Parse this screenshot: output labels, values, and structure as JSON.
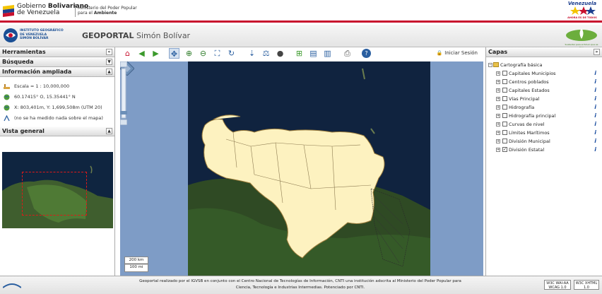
{
  "topbar": {
    "gov_title_light": "Gobierno ",
    "gov_title_bold": "Bolivariano",
    "gov_title_line2": "de Venezuela",
    "ministry_line1": "Ministerio del Poder Popular",
    "ministry_line2_prefix": "para el ",
    "ministry_line2_bold": "Ambiente",
    "badge_text": "Venezuela",
    "badge_subtext": "AHORA ES DE TODOS"
  },
  "header": {
    "institute_line1": "INSTITUTO GEOGRÁFICO",
    "institute_line2": "DE VENEZUELA",
    "institute_line3": "SIMÓN BOLÍVAR",
    "title_bold": "GEOPORTAL",
    "title_light": " Simón Bolívar",
    "eco_caption": "Sustentar para el futuro que es hoy"
  },
  "left_panel": {
    "tools_title": "Herramientas",
    "search_title": "Búsqueda",
    "info_title": "Información ampliada",
    "scale_text": "Escala = 1 : 10,000,000",
    "geo_coords": "60.17415° O, 15.35441° N",
    "utm_coords": "X: 803,401m, Y: 1,699,508m (UTM 20)",
    "measure_text": "(no se ha medido nada sobre el mapa)",
    "overview_title": "Vista general",
    "collapse_glyph": "«",
    "toggle_glyph": "▼",
    "up_glyph": "▲"
  },
  "toolbar": {
    "login_label": "Iniciar Sesión",
    "icons": [
      "home-icon",
      "back-arrow-icon",
      "forward-arrow-icon",
      "pan-icon",
      "zoom-in-icon",
      "zoom-out-icon",
      "zoom-extent-icon",
      "refresh-icon",
      "select-icon",
      "measure-icon",
      "info-icon",
      "add-layer-icon",
      "open-folder-icon",
      "document-icon",
      "print-icon",
      "help-icon"
    ]
  },
  "map": {
    "scale_km": "200 km",
    "scale_mi": "100 mi"
  },
  "right_panel": {
    "title": "Capas",
    "expand_glyph": "»",
    "root_label": "Cartografía básica",
    "info_glyph": "i",
    "layers": [
      {
        "label": "Capitales Municipios",
        "checked": false
      },
      {
        "label": "Centros poblados",
        "checked": false
      },
      {
        "label": "Capitales Estados",
        "checked": false
      },
      {
        "label": "Vías Principal",
        "checked": false
      },
      {
        "label": "Hidrografía",
        "checked": false
      },
      {
        "label": "Hidrografía principal",
        "checked": false
      },
      {
        "label": "Curvas de nivel",
        "checked": false
      },
      {
        "label": "Límites Marítimos",
        "checked": false
      },
      {
        "label": "División Municipal",
        "checked": false
      },
      {
        "label": "División Estatal",
        "checked": true
      }
    ]
  },
  "footer": {
    "line1": "Geoportal realizado por el IGVSB en conjunto con el Centro Nacional de Tecnologías de Información, CNTI una institución adscrita al Ministerio del Poder Popular para",
    "line2": "Ciencia, Tecnología e Industrias Intermedias. Potenciado por CNTI.",
    "badge1": "W3C WAI-AA WCAG 1.0",
    "badge2": "W3C XHTML 1.0"
  },
  "colors": {
    "accent_red": "#c8102e",
    "land_fill": "#fdf2c0",
    "sea": "#10233f"
  }
}
